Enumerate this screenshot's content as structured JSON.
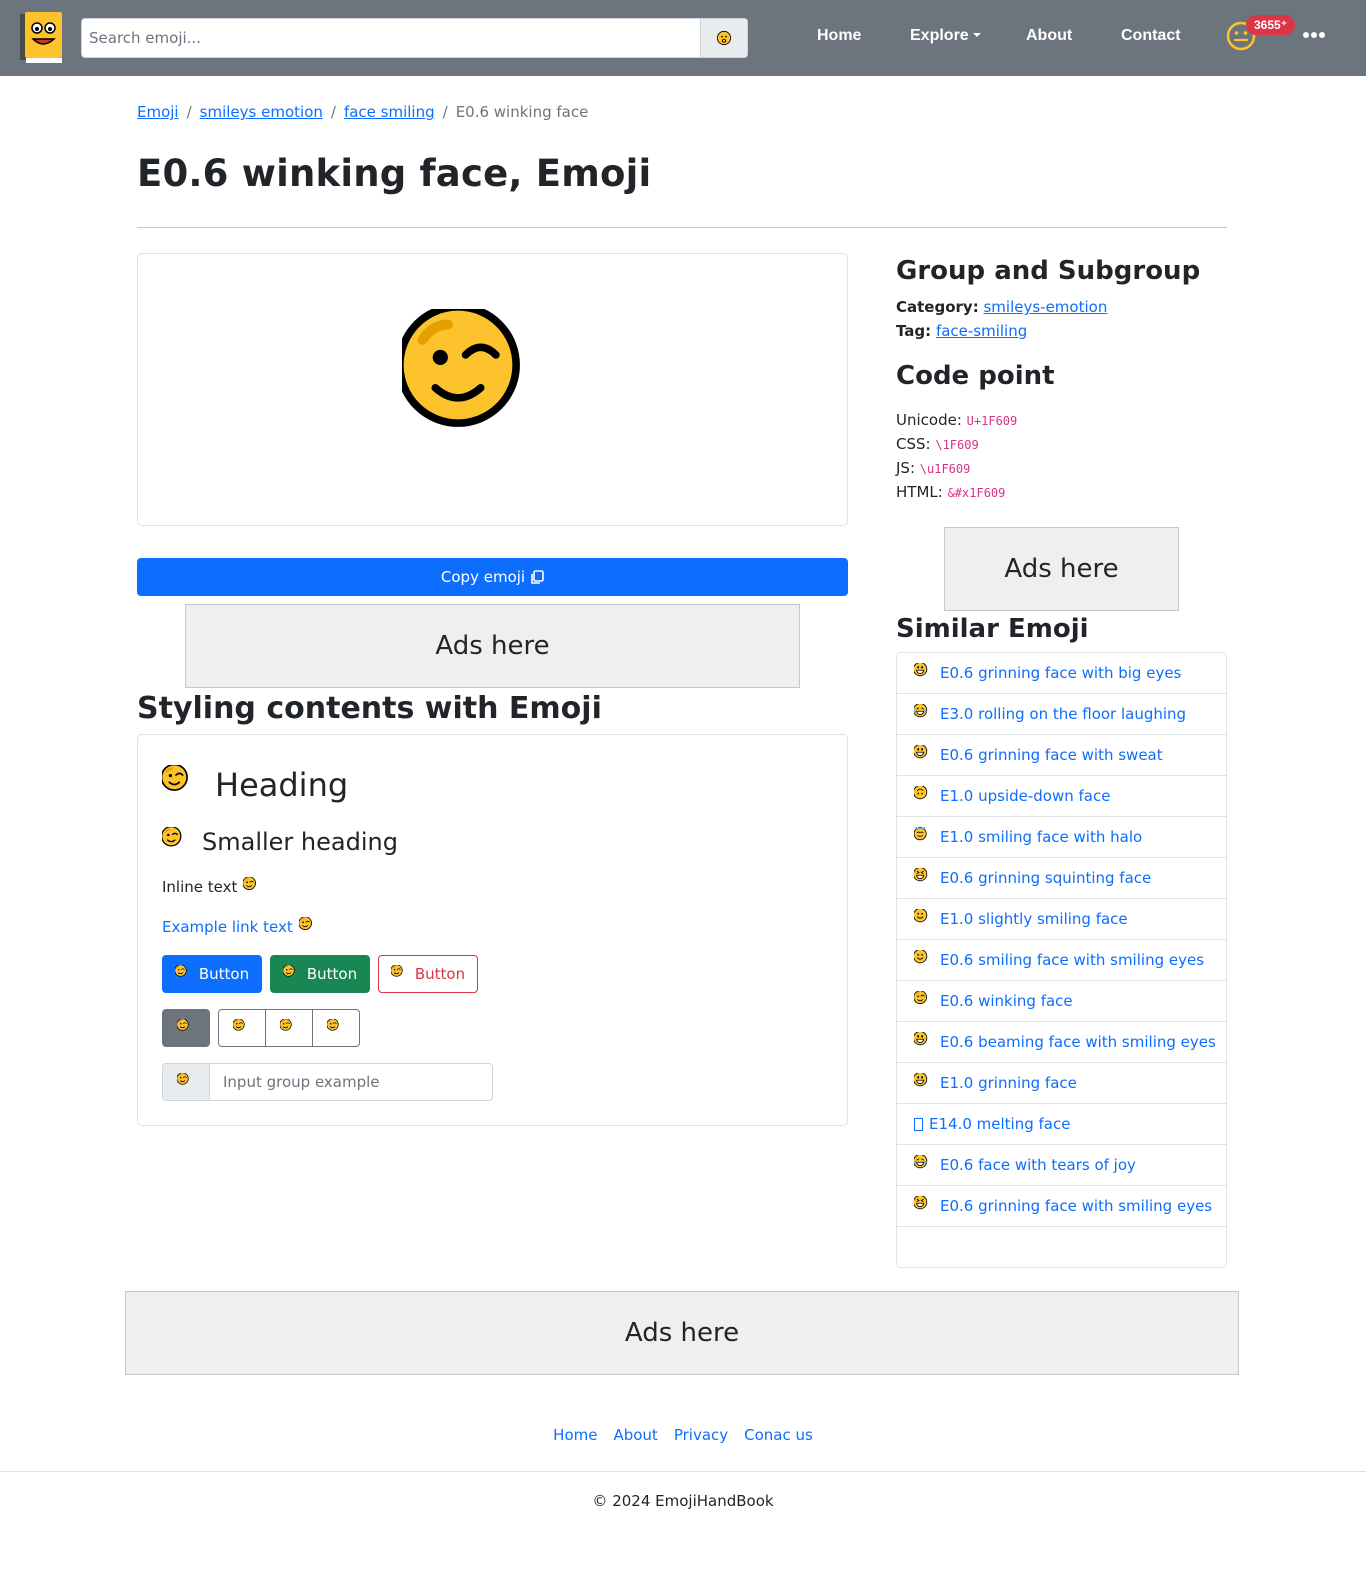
{
  "nav": {
    "search_placeholder": "Search emoji...",
    "links": {
      "home": "Home",
      "explore": "Explore",
      "about": "About",
      "contact": "Contact"
    },
    "badge": "3655⁺"
  },
  "breadcrumb": {
    "emoji": "Emoji",
    "category": "smileys emotion",
    "subcategory": "face smiling",
    "current": "E0.6 winking face"
  },
  "page_title": "E0.6 winking face, Emoji",
  "copy_button": "Copy emoji",
  "ads_label": "Ads here",
  "styling": {
    "title": "Styling contents with Emoji",
    "heading": "Heading",
    "smaller_heading": "Smaller heading",
    "inline_text": "Inline text",
    "link_text": "Example link text",
    "button_label": "Button",
    "input_placeholder": "Input group example"
  },
  "group": {
    "title": "Group and Subgroup",
    "category_label": "Category:",
    "category_value": "smileys-emotion",
    "tag_label": "Tag:",
    "tag_value": "face-smiling"
  },
  "codepoint": {
    "title": "Code point",
    "unicode_label": "Unicode:",
    "unicode": "U+1F609",
    "css_label": "CSS:",
    "css": "\\1F609",
    "js_label": "JS:",
    "js": "\\u1F609",
    "html_label": "HTML:",
    "html": "&#x1F609"
  },
  "similar": {
    "title": "Similar Emoji",
    "items": [
      {
        "label": "E0.6 grinning face with big eyes",
        "icon": "grinning-big-eyes-icon"
      },
      {
        "label": "E3.0 rolling on the floor laughing",
        "icon": "rofl-icon"
      },
      {
        "label": "E0.6 grinning face with sweat",
        "icon": "grinning-sweat-icon"
      },
      {
        "label": "E1.0 upside-down face",
        "icon": "upside-down-icon"
      },
      {
        "label": "E1.0 smiling face with halo",
        "icon": "halo-icon"
      },
      {
        "label": "E0.6 grinning squinting face",
        "icon": "squinting-icon"
      },
      {
        "label": "E1.0 slightly smiling face",
        "icon": "slightly-smiling-icon"
      },
      {
        "label": "E0.6 smiling face with smiling eyes",
        "icon": "smiling-eyes-icon"
      },
      {
        "label": "E0.6 winking face",
        "icon": "winking-icon"
      },
      {
        "label": "E0.6 beaming face with smiling eyes",
        "icon": "beaming-icon"
      },
      {
        "label": "E1.0 grinning face",
        "icon": "grinning-icon"
      },
      {
        "label": "E14.0 melting face",
        "icon": "missing-glyph-icon"
      },
      {
        "label": "E0.6 face with tears of joy",
        "icon": "tears-of-joy-icon"
      },
      {
        "label": "E0.6 grinning face with smiling eyes",
        "icon": "grinning-smiling-eyes-icon"
      }
    ]
  },
  "footer": {
    "links": {
      "home": "Home",
      "about": "About",
      "privacy": "Privacy",
      "contact": "Conac us"
    },
    "copyright": "© 2024 EmojiHandBook"
  },
  "colors": {
    "navbar": "#6c757d",
    "primary": "#0d6efd",
    "success": "#198754",
    "danger": "#dc3545",
    "emoji_yellow": "#fcc32c"
  }
}
